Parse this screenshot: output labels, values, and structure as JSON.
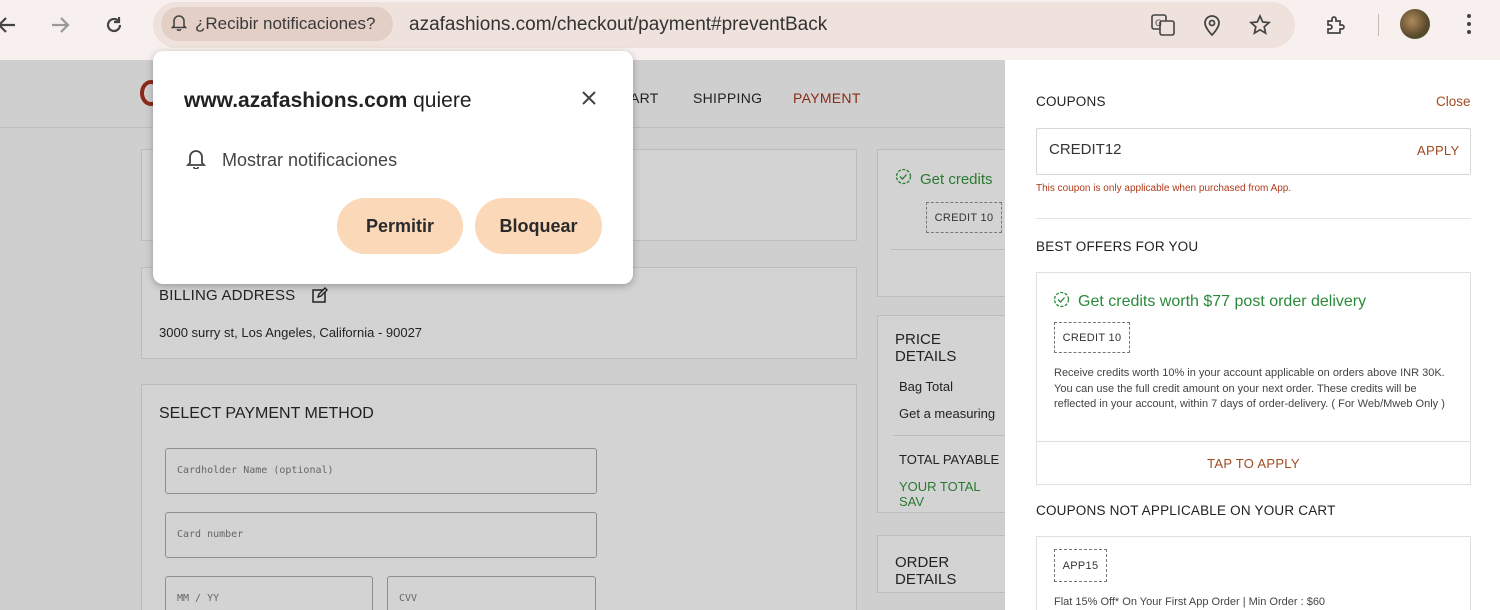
{
  "browser": {
    "notification_chip": "¿Recibir notificaciones?",
    "url": "azafashions.com/checkout/payment#preventBack"
  },
  "popup": {
    "site": "www.azafashions.com",
    "title_suffix": "quiere",
    "permission_label": "Mostrar notificaciones",
    "allow_label": "Permitir",
    "block_label": "Bloquear"
  },
  "steps": {
    "cart": "ART",
    "shipping": "SHIPPING",
    "payment": "PAYMENT"
  },
  "billing": {
    "title": "BILLING ADDRESS",
    "address": "3000 surry st, Los Angeles, California - 90027"
  },
  "payment": {
    "title": "SELECT PAYMENT METHOD",
    "cardholder_placeholder": "Cardholder Name (optional)",
    "card_number_placeholder": "Card number",
    "expiry_placeholder": "MM / YY",
    "cvv_placeholder": "CVV"
  },
  "credits_card": {
    "title": "Get credits",
    "tag": "CREDIT 10"
  },
  "price_details": {
    "title": "PRICE DETAILS",
    "bag_total": "Bag Total",
    "measuring": "Get a measuring",
    "total_payable": "TOTAL PAYABLE",
    "total_savings": "YOUR TOTAL SAV"
  },
  "order_details": {
    "title": "ORDER DETAILS"
  },
  "drawer": {
    "coupons_label": "COUPONS",
    "close_label": "Close",
    "coupon_value": "CREDIT12",
    "apply_label": "APPLY",
    "error": "This coupon is only applicable when purchased from App.",
    "best_offers_label": "BEST OFFERS FOR YOU",
    "offer": {
      "title": "Get credits worth $77 post order delivery",
      "code": "CREDIT 10",
      "description": "Receive credits worth 10% in your account applicable on orders above INR 30K. You can use the full credit amount on your next order. These credits will be reflected in your account, within 7 days of order-delivery. ( For Web/Mweb Only )",
      "tap_label": "TAP TO APPLY"
    },
    "not_applicable_label": "COUPONS NOT APPLICABLE ON YOUR CART",
    "na_offer": {
      "code": "APP15",
      "description": "Flat 15% Off* On Your First App Order | Min Order : $60"
    }
  },
  "colors": {
    "accent": "#a04a1e",
    "green": "#2a8a3a",
    "button": "#fad8b8"
  }
}
